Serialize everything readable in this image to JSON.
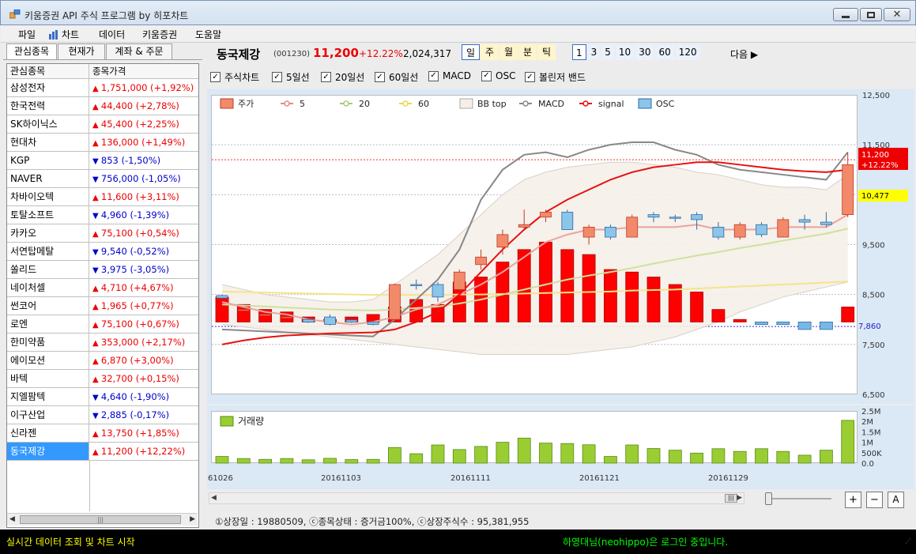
{
  "window": {
    "title": "키움증권 API 주식 프로그램 by 히포차트"
  },
  "menu": [
    "파일",
    "차트",
    "데이터",
    "키움증권",
    "도움말"
  ],
  "tabs": [
    "관심종목",
    "현재가",
    "계좌 & 주문"
  ],
  "watchlist": {
    "headers": [
      "관심종목",
      "종목가격"
    ],
    "rows": [
      {
        "name": "삼성전자",
        "price": "1,751,000 (+1,92%)",
        "dir": "up"
      },
      {
        "name": "한국전력",
        "price": "44,400 (+2,78%)",
        "dir": "up"
      },
      {
        "name": "SK하이닉스",
        "price": "45,400 (+2,25%)",
        "dir": "up"
      },
      {
        "name": "현대차",
        "price": "136,000 (+1,49%)",
        "dir": "up"
      },
      {
        "name": "KGP",
        "price": "853 (-1,50%)",
        "dir": "down"
      },
      {
        "name": "NAVER",
        "price": "756,000 (-1,05%)",
        "dir": "down"
      },
      {
        "name": "차바이오텍",
        "price": "11,600 (+3,11%)",
        "dir": "up"
      },
      {
        "name": "토탈소프트",
        "price": "4,960 (-1,39%)",
        "dir": "down"
      },
      {
        "name": "카카오",
        "price": "75,100 (+0,54%)",
        "dir": "up"
      },
      {
        "name": "서연탑메탈",
        "price": "9,540 (-0,52%)",
        "dir": "down"
      },
      {
        "name": "쏠리드",
        "price": "3,975 (-3,05%)",
        "dir": "down"
      },
      {
        "name": "네이처셀",
        "price": "4,710 (+4,67%)",
        "dir": "up"
      },
      {
        "name": "썬코어",
        "price": "1,965 (+0,77%)",
        "dir": "up"
      },
      {
        "name": "로엔",
        "price": "75,100 (+0,67%)",
        "dir": "up"
      },
      {
        "name": "한미약품",
        "price": "353,000 (+2,17%)",
        "dir": "up"
      },
      {
        "name": "에이모션",
        "price": "6,870 (+3,00%)",
        "dir": "up"
      },
      {
        "name": "바텍",
        "price": "32,700 (+0,15%)",
        "dir": "up"
      },
      {
        "name": "지엘팜텍",
        "price": "4,640 (-1,90%)",
        "dir": "down"
      },
      {
        "name": "이구산업",
        "price": "2,885 (-0,17%)",
        "dir": "down"
      },
      {
        "name": "신라젠",
        "price": "13,750 (+1,85%)",
        "dir": "up"
      },
      {
        "name": "동국제강",
        "price": "11,200 (+12,22%)",
        "dir": "up",
        "selected": true
      }
    ]
  },
  "stock": {
    "name": "동국제강",
    "code": "(001230)",
    "price": "11,200",
    "change": "+12.22%",
    "volume": "2,024,317"
  },
  "periods": [
    "일",
    "주",
    "월",
    "분",
    "틱"
  ],
  "intervals": [
    "1",
    "3",
    "5",
    "10",
    "30",
    "60",
    "120"
  ],
  "next_label": "다음 ▶",
  "indicators": [
    "주식차트",
    "5일선",
    "20일선",
    "60일선",
    "MACD",
    "OSC",
    "볼린저 밴드"
  ],
  "legend": [
    "주가",
    "5",
    "20",
    "60",
    "BB top",
    "MACD",
    "signal",
    "OSC"
  ],
  "price_axis": [
    "12,500",
    "11,500",
    "9,500",
    "8,500",
    "7,500",
    "6,500"
  ],
  "price_tags": {
    "current": "11,200",
    "current_change": "+12.22%",
    "ma_level": "10,477",
    "macd_level": "7,860"
  },
  "volume_label": "거래량",
  "volume_axis": [
    "2.5M",
    "2M",
    "1.5M",
    "1M",
    "500K",
    "0.0"
  ],
  "date_axis": [
    "61026",
    "20161103",
    "20161111",
    "20161121",
    "20161129"
  ],
  "info_line": "①상장일 : 19880509, ⓒ종목상태 : 증거금100%, ⓒ상장주식수 : 95,381,955",
  "zoom_buttons": [
    "+",
    "−",
    "A"
  ],
  "status": {
    "left": "실시간 데이터 조회 및 차트 시작",
    "right": "하영대님(neohippo)은 로그인 중입니다."
  },
  "chart_data": {
    "type": "candlestick",
    "price_range": [
      6500,
      12500
    ],
    "candles": [
      {
        "o": 8480,
        "c": 8430,
        "h": 8500,
        "l": 8400
      },
      {
        "o": 8200,
        "c": 8200,
        "h": 8220,
        "l": 8180
      },
      {
        "o": 8100,
        "c": 8100,
        "h": 8120,
        "l": 8080
      },
      {
        "o": 8050,
        "c": 8050,
        "h": 8070,
        "l": 8030
      },
      {
        "o": 8000,
        "c": 7950,
        "h": 8020,
        "l": 7930
      },
      {
        "o": 8050,
        "c": 7900,
        "h": 8100,
        "l": 7880
      },
      {
        "o": 7990,
        "c": 7950,
        "h": 8010,
        "l": 7930
      },
      {
        "o": 7950,
        "c": 7900,
        "h": 7970,
        "l": 7880
      },
      {
        "o": 8000,
        "c": 8700,
        "h": 8720,
        "l": 7990
      },
      {
        "o": 8700,
        "c": 8680,
        "h": 8800,
        "l": 8600
      },
      {
        "o": 8700,
        "c": 8450,
        "h": 8750,
        "l": 8350
      },
      {
        "o": 8600,
        "c": 8950,
        "h": 9000,
        "l": 8550
      },
      {
        "o": 9100,
        "c": 9250,
        "h": 9400,
        "l": 9000
      },
      {
        "o": 9450,
        "c": 9700,
        "h": 9800,
        "l": 9300
      },
      {
        "o": 9850,
        "c": 9900,
        "h": 10200,
        "l": 9800
      },
      {
        "o": 10050,
        "c": 10150,
        "h": 10200,
        "l": 9950
      },
      {
        "o": 10150,
        "c": 9800,
        "h": 10200,
        "l": 9800
      },
      {
        "o": 9650,
        "c": 9850,
        "h": 9900,
        "l": 9500
      },
      {
        "o": 9850,
        "c": 9650,
        "h": 9900,
        "l": 9600
      },
      {
        "o": 9650,
        "c": 10050,
        "h": 10100,
        "l": 9650
      },
      {
        "o": 10100,
        "c": 10050,
        "h": 10150,
        "l": 9950
      },
      {
        "o": 10050,
        "c": 10030,
        "h": 10100,
        "l": 9950
      },
      {
        "o": 10100,
        "c": 10000,
        "h": 10150,
        "l": 9800
      },
      {
        "o": 9850,
        "c": 9650,
        "h": 9950,
        "l": 9600
      },
      {
        "o": 9650,
        "c": 9900,
        "h": 9950,
        "l": 9600
      },
      {
        "o": 9900,
        "c": 9700,
        "h": 9950,
        "l": 9650
      },
      {
        "o": 9650,
        "c": 10000,
        "h": 10050,
        "l": 9650
      },
      {
        "o": 10000,
        "c": 9950,
        "h": 10100,
        "l": 9800
      },
      {
        "o": 9950,
        "c": 9900,
        "h": 10150,
        "l": 9850
      },
      {
        "o": 10100,
        "c": 11100,
        "h": 11350,
        "l": 10050
      }
    ],
    "osc": [
      8450,
      8300,
      8200,
      8150,
      8050,
      8000,
      8050,
      8100,
      8250,
      8400,
      8300,
      8750,
      8850,
      9150,
      9400,
      9550,
      9400,
      9300,
      9000,
      8950,
      8850,
      8700,
      8550,
      8200,
      8000,
      7900,
      7900,
      7800,
      7800,
      8250
    ],
    "osc_base": 7950,
    "ma5": [
      8350,
      8250,
      8150,
      8100,
      8000,
      7950,
      7900,
      7950,
      8050,
      8200,
      8300,
      8500,
      8700,
      8950,
      9250,
      9550,
      9700,
      9800,
      9800,
      9850,
      9850,
      9850,
      9900,
      9800,
      9800,
      9800,
      9850,
      9850,
      9850,
      10100
    ],
    "ma20": [
      8300,
      8280,
      8260,
      8240,
      8220,
      8200,
      8190,
      8180,
      8200,
      8230,
      8260,
      8320,
      8400,
      8500,
      8600,
      8700,
      8800,
      8880,
      8950,
      9030,
      9120,
      9200,
      9280,
      9350,
      9430,
      9500,
      9580,
      9650,
      9720,
      9820
    ],
    "ma60": [
      8560,
      8550,
      8540,
      8530,
      8520,
      8510,
      8500,
      8490,
      8490,
      8490,
      8490,
      8500,
      8500,
      8510,
      8520,
      8530,
      8540,
      8550,
      8560,
      8580,
      8590,
      8600,
      8620,
      8640,
      8660,
      8680,
      8700,
      8720,
      8740,
      8760
    ],
    "bb_top": [
      8700,
      8600,
      8500,
      8450,
      8400,
      8350,
      8350,
      8400,
      8700,
      9000,
      9300,
      9700,
      10100,
      10500,
      10800,
      10950,
      11050,
      11100,
      11150,
      11150,
      11100,
      11050,
      10950,
      10900,
      10800,
      10700,
      10650,
      10650,
      10600,
      10900
    ],
    "bb_bot": [
      7900,
      7850,
      7800,
      7750,
      7700,
      7650,
      7600,
      7550,
      7500,
      7450,
      7400,
      7350,
      7300,
      7300,
      7300,
      7300,
      7300,
      7350,
      7400,
      7450,
      7550,
      7650,
      7800,
      7950,
      8150,
      8300,
      8450,
      8550,
      8650,
      8750
    ],
    "macd": [
      7800,
      7780,
      7760,
      7740,
      7720,
      7700,
      7680,
      7660,
      8000,
      8400,
      8800,
      9400,
      10400,
      11000,
      11300,
      11350,
      11250,
      11400,
      11500,
      11550,
      11550,
      11400,
      11300,
      11100,
      11000,
      10950,
      10900,
      10850,
      10800,
      11350
    ],
    "signal": [
      7500,
      7580,
      7640,
      7680,
      7700,
      7720,
      7730,
      7740,
      7800,
      7950,
      8150,
      8500,
      8950,
      9400,
      9800,
      10150,
      10400,
      10600,
      10800,
      10950,
      11050,
      11100,
      11150,
      11150,
      11100,
      11050,
      11000,
      10970,
      10950,
      11000
    ],
    "volume_range": [
      0,
      2500000
    ],
    "volume": [
      320000,
      220000,
      180000,
      220000,
      160000,
      230000,
      170000,
      180000,
      750000,
      450000,
      870000,
      650000,
      800000,
      1000000,
      1200000,
      960000,
      940000,
      880000,
      320000,
      870000,
      700000,
      620000,
      480000,
      690000,
      560000,
      690000,
      560000,
      380000,
      620000,
      2050000
    ]
  }
}
